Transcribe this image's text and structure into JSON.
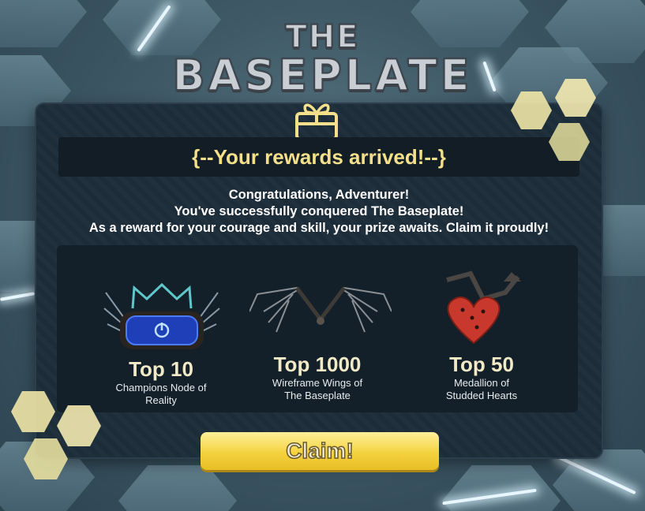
{
  "game": {
    "title_line1": "THE",
    "title_line2": "BASEPLATE"
  },
  "popup": {
    "banner": "{--Your rewards arrived!--}",
    "message_lines": [
      "Congratulations, Adventurer!",
      "You've successfully conquered The Baseplate!",
      "As a reward for your courage and skill, your prize awaits. Claim it proudly!"
    ],
    "rewards": [
      {
        "rank": "Top 10",
        "name_line1": "Champions Node of",
        "name_line2": "Reality",
        "icon": "visor-crown-icon"
      },
      {
        "rank": "Top 1000",
        "name_line1": "Wireframe Wings of",
        "name_line2": "The Baseplate",
        "icon": "wings-icon"
      },
      {
        "rank": "Top 50",
        "name_line1": "Medallion of",
        "name_line2": "Studded Hearts",
        "icon": "heart-medallion-icon"
      }
    ],
    "claim_label": "Claim!"
  },
  "colors": {
    "accent_yellow": "#f4d23f",
    "banner_text": "#f4e08a",
    "panel_bg": "#1c2c38"
  }
}
